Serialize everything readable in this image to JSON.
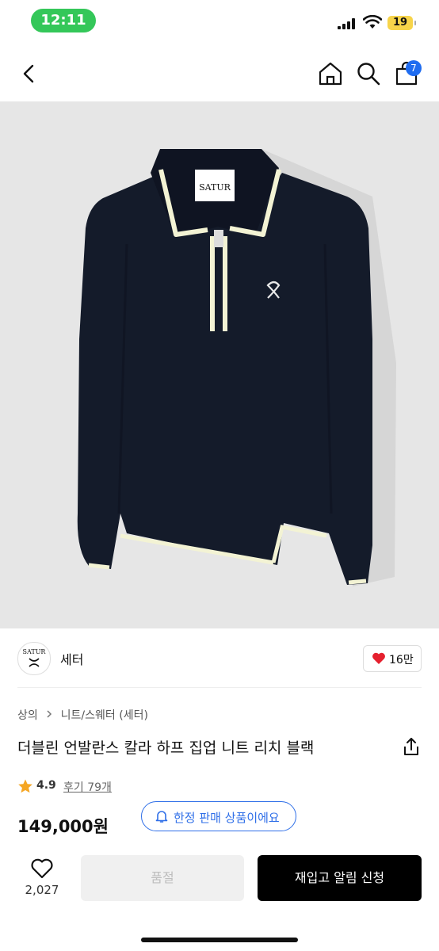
{
  "status_bar": {
    "time": "12:11",
    "battery": "19"
  },
  "nav": {
    "cart_count": "7"
  },
  "product_image": {
    "brand_label": "SATUR"
  },
  "brand": {
    "logo_text": "SATUR",
    "name": "세터",
    "like_count": "16만"
  },
  "breadcrumb": {
    "items": [
      "상의",
      "니트/스웨터 (세터)"
    ]
  },
  "product": {
    "title": "더블린 언발란스 칼라 하프 집업 니트 리치 블랙",
    "rating": "4.9",
    "reviews": "후기 79개",
    "price": "149,000원",
    "limited_badge": "한정 판매 상품이에요"
  },
  "bottom_bar": {
    "wish_count": "2,027",
    "soldout_label": "품절",
    "restock_label": "재입고 알림 신청"
  },
  "colors": {
    "accent": "#2f6fe8",
    "status_green": "#34c759",
    "like_red": "#e5202e",
    "star": "#f5a623"
  }
}
